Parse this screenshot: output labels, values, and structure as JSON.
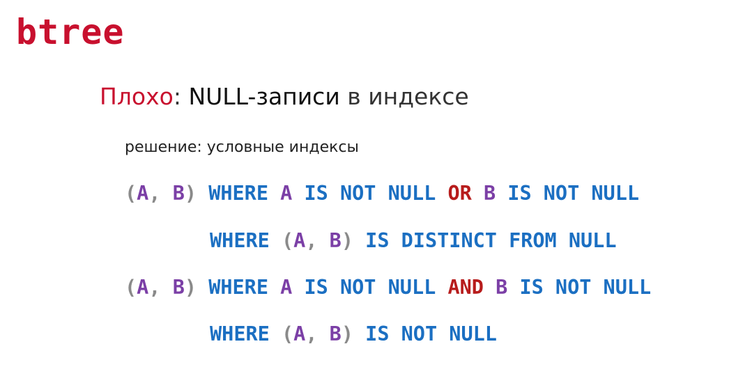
{
  "slide": {
    "title": "btree",
    "heading": {
      "label": "Плохо",
      "colon": ":",
      "subject": "NULL-записи",
      "rest": "в индексе"
    },
    "subheading": "решение: условные индексы",
    "code_lines": [
      {
        "tokens": [
          "(",
          "A",
          ",",
          "B",
          ")",
          "WHERE",
          "A",
          "IS NOT NULL",
          "OR",
          "B",
          "IS NOT NULL"
        ]
      },
      {
        "tokens": [
          "WHERE",
          "(",
          "A",
          ",",
          "B",
          ")",
          "IS DISTINCT FROM NULL"
        ]
      },
      {
        "tokens": [
          "(",
          "A",
          ",",
          "B",
          ")",
          "WHERE",
          "A",
          "IS NOT NULL",
          "AND",
          "B",
          "IS NOT NULL"
        ]
      },
      {
        "tokens": [
          "WHERE",
          "(",
          "A",
          ",",
          "B",
          ")",
          "IS NOT NULL"
        ]
      }
    ]
  },
  "colors": {
    "title": "#c8102e",
    "bad_label": "#c8102e",
    "punctuation": "#8a8a8a",
    "column": "#7b3fa6",
    "keyword": "#1b6fc2",
    "operator": "#b71c1c"
  }
}
